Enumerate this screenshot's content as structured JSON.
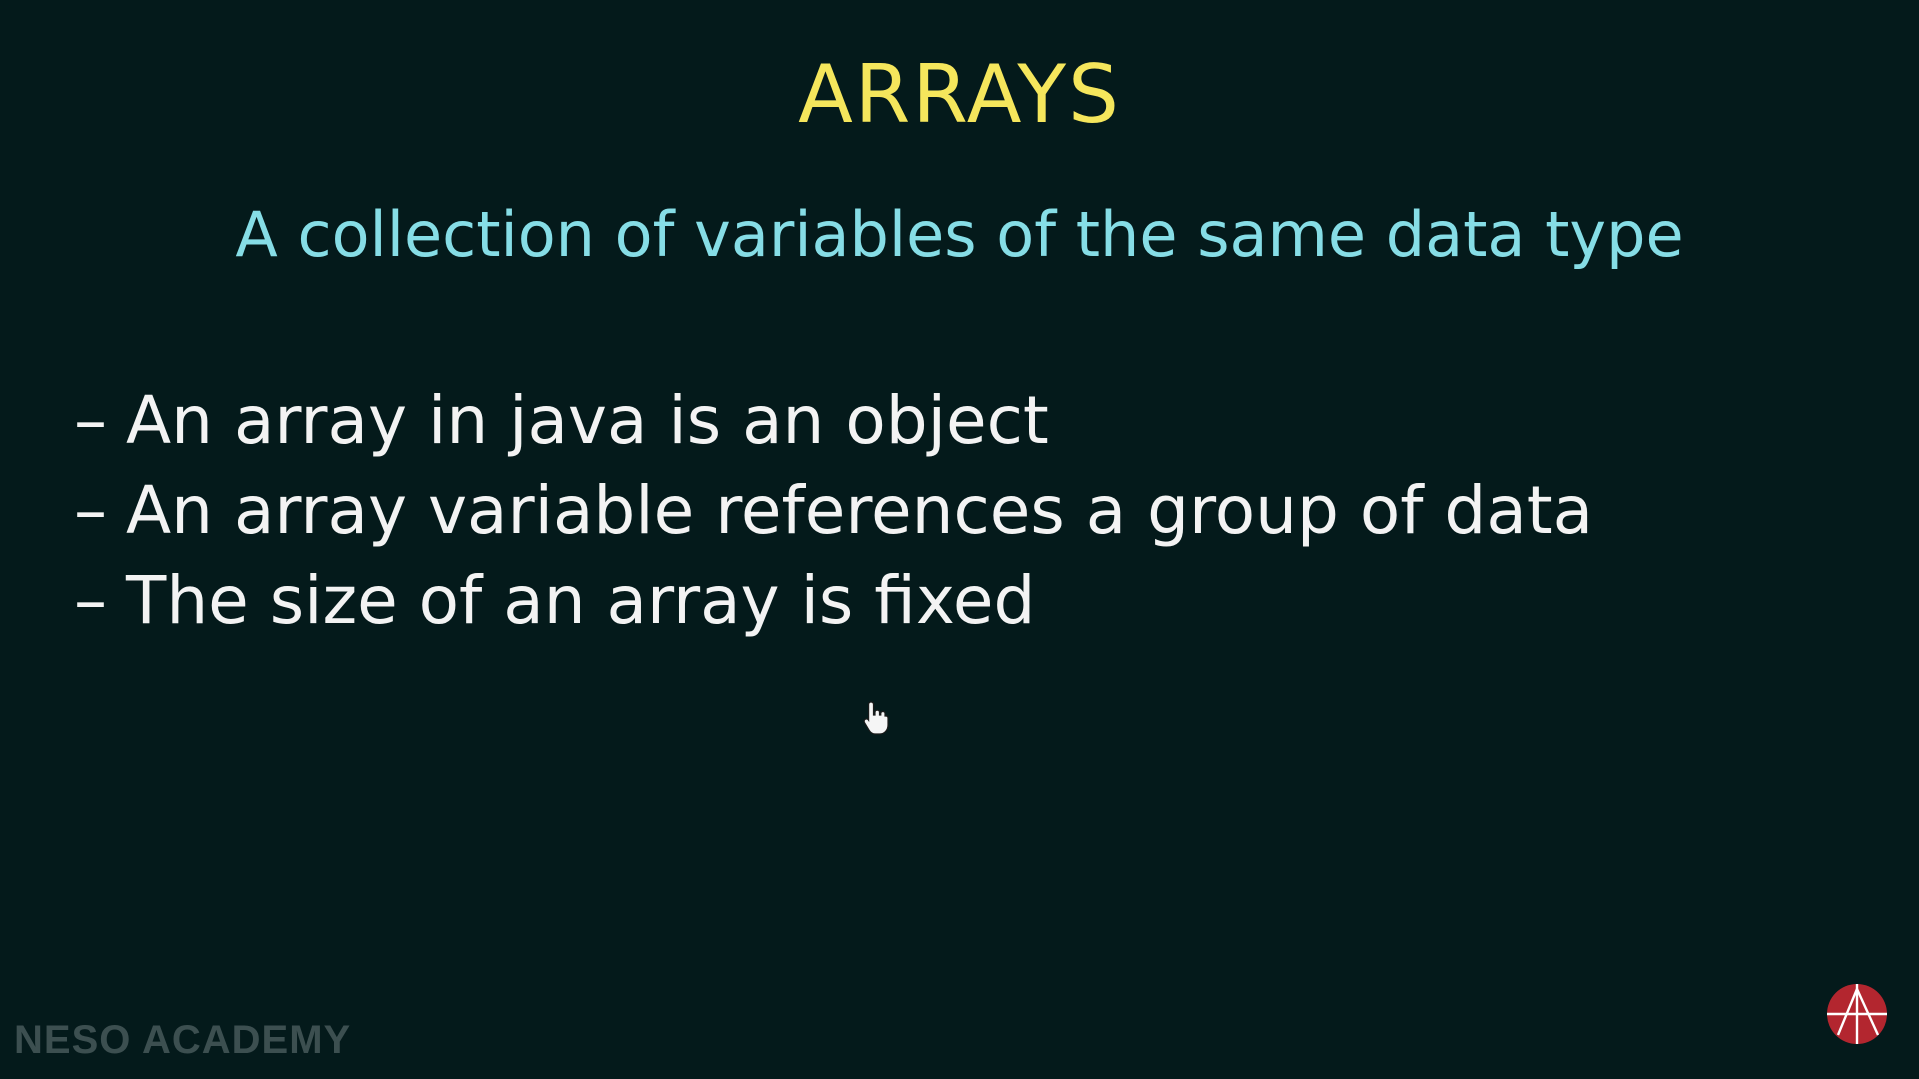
{
  "slide": {
    "title": "ARRAYS",
    "subtitle": "A collection of variables of the same data type",
    "bullets": [
      {
        "marker": "–",
        "text": "An array in java is an object"
      },
      {
        "marker": "–",
        "text": "An array variable references a group of data"
      },
      {
        "marker": "–",
        "text": "The size of an array is fixed"
      }
    ]
  },
  "branding": {
    "watermark": "NESO ACADEMY",
    "logo_icon": "neso-academy-logo-icon"
  },
  "cursor_icon": "hand-pointer-icon",
  "colors": {
    "background": "#041a1b",
    "title": "#f5e65c",
    "subtitle": "#86dde6",
    "body_text": "#f3f3f3",
    "logo": "#b3262f"
  }
}
